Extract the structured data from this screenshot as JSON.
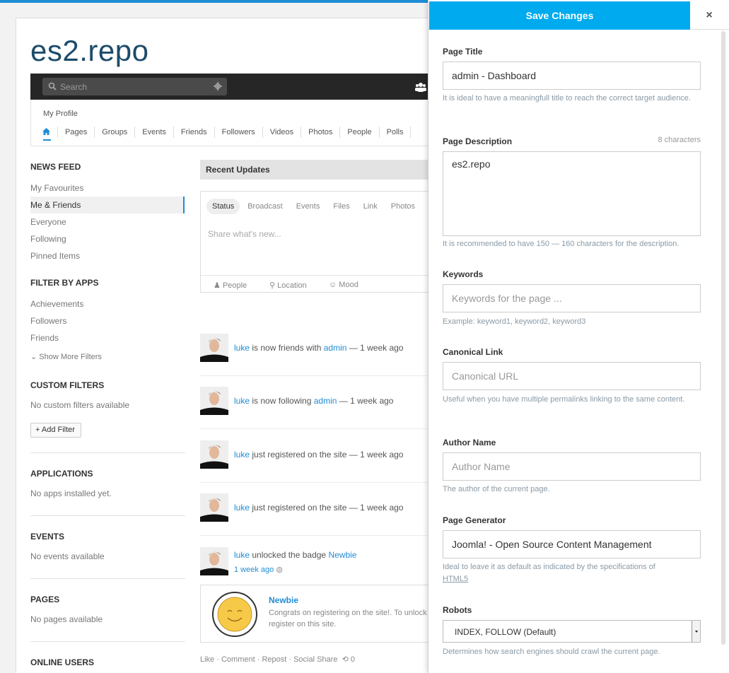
{
  "site": {
    "title": "es2.repo",
    "search_placeholder": "Search"
  },
  "subnav": {
    "my_profile": "My Profile",
    "links": [
      "Pages",
      "Groups",
      "Events",
      "Friends",
      "Followers",
      "Videos",
      "Photos",
      "People",
      "Polls"
    ]
  },
  "sidebar": {
    "news_feed": {
      "heading": "NEWS FEED",
      "items": [
        "My Favourites",
        "Me & Friends",
        "Everyone",
        "Following",
        "Pinned Items"
      ],
      "active_index": 1
    },
    "filter_by_apps": {
      "heading": "FILTER BY APPS",
      "items": [
        "Achievements",
        "Followers",
        "Friends"
      ],
      "more": "Show More Filters"
    },
    "custom_filters": {
      "heading": "CUSTOM FILTERS",
      "empty": "No custom filters available",
      "add_label": "Add Filter"
    },
    "applications": {
      "heading": "APPLICATIONS",
      "empty": "No apps installed yet."
    },
    "events": {
      "heading": "EVENTS",
      "empty": "No events available"
    },
    "pages": {
      "heading": "PAGES",
      "empty": "No pages available"
    },
    "online_users": {
      "heading": "ONLINE USERS"
    }
  },
  "feed": {
    "heading": "Recent Updates",
    "composer": {
      "tabs": [
        "Status",
        "Broadcast",
        "Events",
        "Files",
        "Link",
        "Photos"
      ],
      "placeholder": "Share what's new...",
      "people": "People",
      "location": "Location",
      "mood": "Mood"
    },
    "stories": [
      {
        "actor": "luke",
        "text": " is now friends with ",
        "target": "admin",
        "time": " — 1 week ago"
      },
      {
        "actor": "luke",
        "text": " is now following ",
        "target": "admin",
        "time": " — 1 week ago"
      },
      {
        "actor": "luke",
        "text": " just registered on the site",
        "target": "",
        "time": " — 1 week ago"
      },
      {
        "actor": "luke",
        "text": " just registered on the site",
        "target": "",
        "time": " — 1 week ago"
      },
      {
        "actor": "luke",
        "text": " unlocked the badge ",
        "target": "Newbie",
        "time": "1 week ago"
      }
    ],
    "badge": {
      "name": "Newbie",
      "description": "Congrats on registering on the site!. To unlock to register on this site."
    },
    "actions": {
      "like": "Like",
      "comment": "Comment",
      "repost": "Repost",
      "share": "Social Share",
      "repost_count": "0"
    }
  },
  "panel": {
    "save_label": "Save Changes",
    "close_label": "×",
    "fields": {
      "title": {
        "label": "Page Title",
        "value": "admin - Dashboard",
        "help": "It is ideal to have a meaningfull title to reach the correct target audience."
      },
      "description": {
        "label": "Page Description",
        "count": "8 characters",
        "value": "es2.repo",
        "help": "It is recommended to have 150 — 160 characters for the description."
      },
      "keywords": {
        "label": "Keywords",
        "placeholder": "Keywords for the page ...",
        "help": "Example: keyword1, keyword2, keyword3"
      },
      "canonical": {
        "label": "Canonical Link",
        "placeholder": "Canonical URL",
        "help": "Useful when you have multiple permalinks linking to the same content."
      },
      "author": {
        "label": "Author Name",
        "placeholder": "Author Name",
        "help": "The author of the current page."
      },
      "generator": {
        "label": "Page Generator",
        "value": "Joomla! - Open Source Content Management",
        "help": "Ideal to leave it as default as indicated by the specifications of",
        "help_link": "HTML5"
      },
      "robots": {
        "label": "Robots",
        "value": "INDEX, FOLLOW (Default)",
        "help": "Determines how search engines should crawl the current page."
      }
    }
  },
  "colors": {
    "accent": "#1f8dd6",
    "save_button": "#00aaee",
    "title": "#1c4b6a",
    "dark_bar": "#262626"
  }
}
